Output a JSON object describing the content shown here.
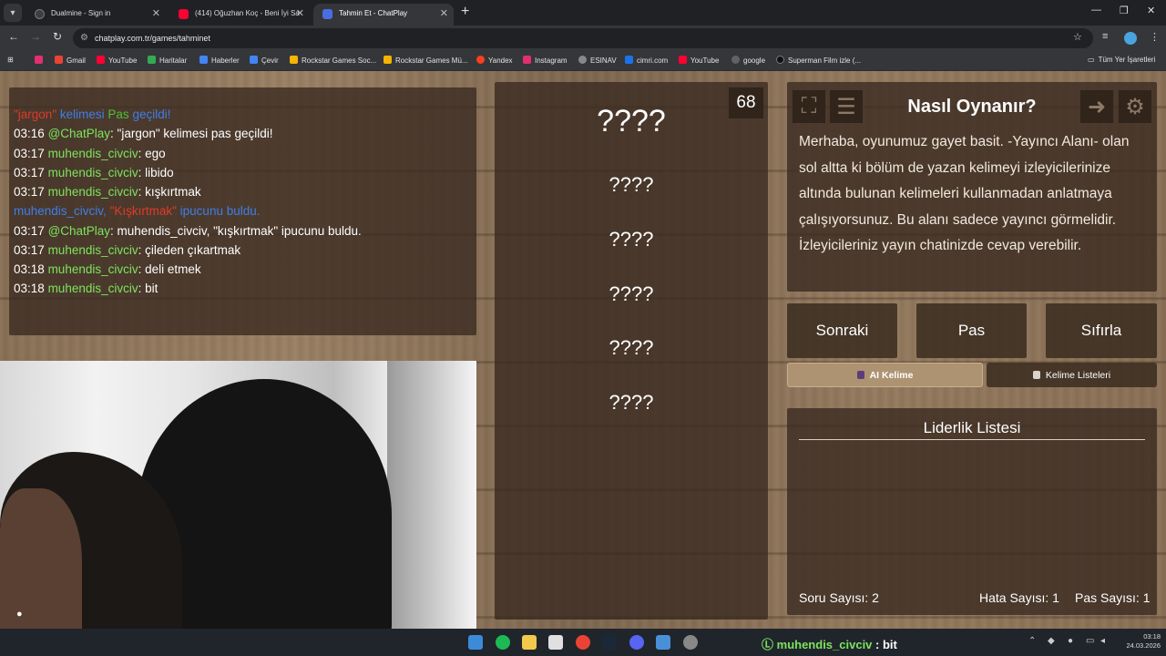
{
  "browser": {
    "tabs": [
      {
        "title": "Dualmine - Sign in",
        "color": "#3c4043"
      },
      {
        "title": "(414) Oğuzhan Koç - Beni İyi Sa",
        "color": "#ff0033"
      },
      {
        "title": "Tahmin Et - ChatPlay",
        "color": "#4a6ee0"
      }
    ],
    "url": "chatplay.com.tr/games/tahminet",
    "bookmarks": [
      {
        "label": "Gmail",
        "color": "#ea4335"
      },
      {
        "label": "YouTube",
        "color": "#ff0033"
      },
      {
        "label": "Haritalar",
        "color": "#34a853"
      },
      {
        "label": "Haberler",
        "color": "#4285f4"
      },
      {
        "label": "Çevir",
        "color": "#4285f4"
      },
      {
        "label": "Rockstar Games Soc...",
        "color": "#f5b400"
      },
      {
        "label": "Rockstar Games Mü...",
        "color": "#f5b400"
      },
      {
        "label": "Yandex",
        "color": "#fc3f1d"
      },
      {
        "label": "Instagram",
        "color": "#e1306c"
      },
      {
        "label": "ESINAV",
        "color": "#888888"
      },
      {
        "label": "cimri.com",
        "color": "#1a73e8"
      },
      {
        "label": "YouTube",
        "color": "#ff0033"
      },
      {
        "label": "google",
        "color": "#5f6368"
      },
      {
        "label": "Superman Film izle (...",
        "color": "#222222"
      }
    ],
    "all_bookmarks": "Tüm Yer İşaretleri"
  },
  "chat": {
    "system1": {
      "quote": "\"jargon\"",
      "word": "kelimesi",
      "pas": "Pas",
      "end": "geçildi!"
    },
    "lines": [
      {
        "time": "03:16",
        "user": "@ChatPlay",
        "text": ": \"jargon\" kelimesi pas geçildi!"
      },
      {
        "time": "03:17",
        "user": "muhendis_civciv",
        "text": ": ego"
      },
      {
        "time": "03:17",
        "user": "muhendis_civciv",
        "text": ": libido"
      },
      {
        "time": "03:17",
        "user": "muhendis_civciv",
        "text": ": kışkırtmak"
      }
    ],
    "system2": {
      "user": "muhendis_civciv,",
      "word": "\"Kışkırtmak\"",
      "end": "ipucunu buldu."
    },
    "lines2": [
      {
        "time": "03:17",
        "user": "@ChatPlay",
        "text": ": muhendis_civciv, \"kışkırtmak\" ipucunu buldu."
      },
      {
        "time": "03:17",
        "user": "muhendis_civciv",
        "text": ": çileden çıkartmak"
      },
      {
        "time": "03:18",
        "user": "muhendis_civciv",
        "text": ": deli etmek"
      },
      {
        "time": "03:18",
        "user": "muhendis_civciv",
        "text": ": bit"
      }
    ]
  },
  "game": {
    "counter": "68",
    "hidden_word": "????",
    "hints": [
      "????",
      "????",
      "????",
      "????",
      "????"
    ],
    "rules_title": "Nasıl Oynanır?",
    "rules_text": "Merhaba, oyunumuz gayet basit. -Yayıncı Alanı- olan sol altta ki bölüm de yazan kelimeyi izleyicilerinize altında bulunan kelimeleri kullanmadan anlatmaya çalışıyorsunuz. Bu alanı sadece yayıncı görmelidir. İzleyicileriniz yayın chatinizde cevap verebilir.",
    "buttons": {
      "next": "Sonraki",
      "pass": "Pas",
      "reset": "Sıfırla"
    },
    "tabs": {
      "ai": "AI Kelime",
      "lists": "Kelime Listeleri"
    },
    "leaderboard_title": "Liderlik Listesi",
    "stats": {
      "questions": "Soru Sayısı: 2",
      "errors": "Hata Sayısı: 1",
      "passes": "Pas Sayısı: 1"
    }
  },
  "taskbar": {
    "chat_user": "muhendis_civciv",
    "chat_text": " : bit",
    "time": "03:18",
    "date": "24.03.2026"
  }
}
